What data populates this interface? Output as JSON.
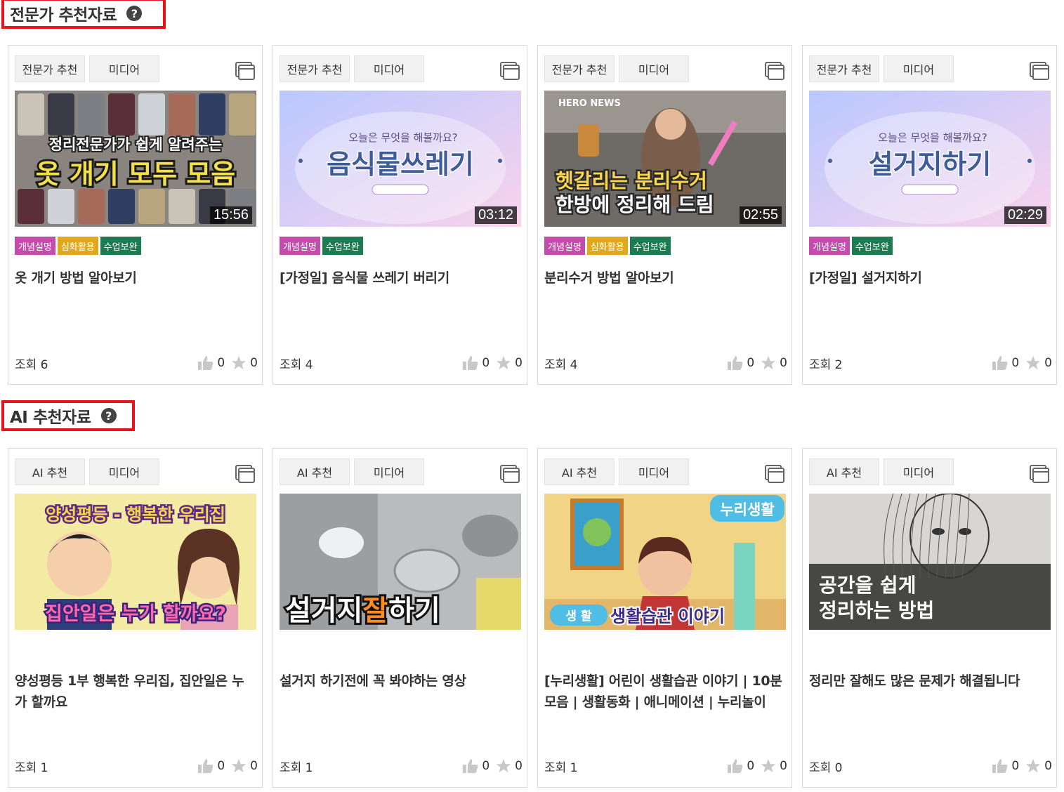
{
  "sections": [
    {
      "title": "전문가 추천자료",
      "help": "?"
    },
    {
      "title": "AI 추천자료",
      "help": "?"
    }
  ],
  "media_label": "미디어",
  "badge_labels": {
    "concept": "개념설명",
    "advanced": "심화활용",
    "supplement": "수업보완"
  },
  "expert_cards": [
    {
      "kind": "전문가 추천",
      "duration": "15:56",
      "badges": [
        "개념설명",
        "심화활용",
        "수업보완"
      ],
      "title": "옷 개기 방법 알아보기",
      "views": "조회 6",
      "likes": "0",
      "stars": "0",
      "thumb_text": [
        "정리전문가가 쉽게 알려주는",
        "옷 개기 모두 모음"
      ]
    },
    {
      "kind": "전문가 추천",
      "duration": "03:12",
      "badges": [
        "개념설명",
        "수업보완"
      ],
      "title": "[가정일] 음식물 쓰레기 버리기",
      "views": "조회 4",
      "likes": "0",
      "stars": "0",
      "thumb_text": [
        "오늘은 무엇을 해볼까요?",
        "음식물쓰레기"
      ]
    },
    {
      "kind": "전문가 추천",
      "duration": "02:55",
      "badges": [
        "개념설명",
        "심화활용",
        "수업보완"
      ],
      "title": "분리수거 방법 알아보기",
      "views": "조회 4",
      "likes": "0",
      "stars": "0",
      "thumb_text": [
        "HERO NEWS",
        "헷갈리는 분리수거",
        "한방에 정리해 드림"
      ]
    },
    {
      "kind": "전문가 추천",
      "duration": "02:29",
      "badges": [
        "개념설명",
        "수업보완"
      ],
      "title": "[가정일] 설거지하기",
      "views": "조회 2",
      "likes": "0",
      "stars": "0",
      "thumb_text": [
        "오늘은 무엇을 해볼까요?",
        "설거지하기"
      ]
    }
  ],
  "ai_cards": [
    {
      "kind": "AI 추천",
      "title": "양성평등 1부 행복한 우리집, 집안일은 누가 할까요",
      "views": "조회 1",
      "likes": "0",
      "stars": "0",
      "thumb_text": [
        "양성평등 - 행복한 우리집",
        "집안일은 누가 할까요?"
      ]
    },
    {
      "kind": "AI 추천",
      "title": "설거지 하기전에 꼭 봐야하는 영상",
      "views": "조회 1",
      "likes": "0",
      "stars": "0",
      "thumb_text": [
        "설거지",
        "잘",
        "하기"
      ]
    },
    {
      "kind": "AI 추천",
      "title": "[누리생활] 어린이 생활습관 이야기 | 10분 모음 | 생활동화 | 애니메이션 | 누리놀이",
      "views": "조회 1",
      "likes": "0",
      "stars": "0",
      "thumb_text": [
        "누리생활",
        "생 활",
        "생활습관 이야기"
      ]
    },
    {
      "kind": "AI 추천",
      "title": "정리만 잘해도 많은 문제가 해결됩니다",
      "views": "조회 0",
      "likes": "0",
      "stars": "0",
      "thumb_text": [
        "공간을 쉽게",
        "정리하는 방법"
      ]
    }
  ]
}
